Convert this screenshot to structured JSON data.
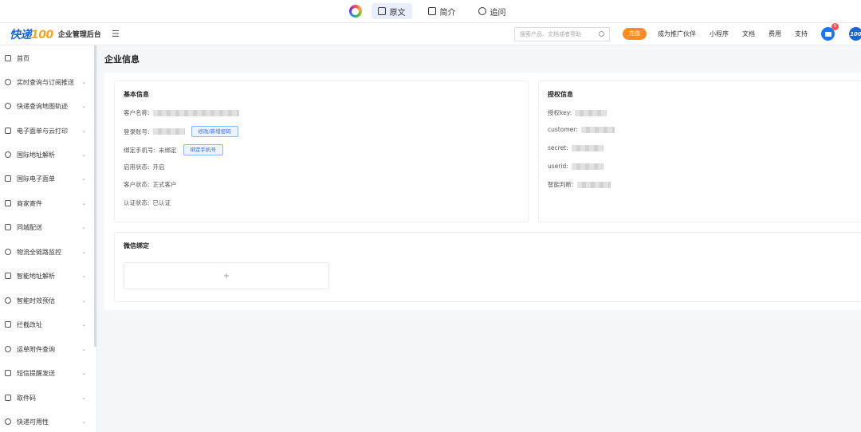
{
  "topbar": {
    "tabs": [
      {
        "label": "原文",
        "active": true
      },
      {
        "label": "简介",
        "active": false
      },
      {
        "label": "追问",
        "active": false
      }
    ]
  },
  "header": {
    "brand_cn": "快递",
    "brand_num": "100",
    "brand_title": "企业管理后台",
    "menu_toggle": "☰",
    "search_placeholder": "搜索产品、文档或者帮助",
    "recharge": "充值",
    "links": [
      "成为推广伙伴",
      "小程序",
      "文档",
      "费用",
      "支持"
    ],
    "mail_badge": "9",
    "avatar": "100"
  },
  "sidebar": {
    "items": [
      {
        "label": "首页",
        "icon": "home-icon",
        "expand": false
      },
      {
        "label": "实时查询与订阅推送",
        "icon": "location-icon",
        "expand": true
      },
      {
        "label": "快递查询地图轨迹",
        "icon": "map-icon",
        "expand": true
      },
      {
        "label": "电子面单与云打印",
        "icon": "printer-icon",
        "expand": true
      },
      {
        "label": "国际地址解析",
        "icon": "pin-icon",
        "expand": true
      },
      {
        "label": "国际电子面单",
        "icon": "document-icon",
        "expand": true
      },
      {
        "label": "商家寄件",
        "icon": "store-icon",
        "expand": true
      },
      {
        "label": "同城配送",
        "icon": "package-icon",
        "expand": true
      },
      {
        "label": "物流全链路监控",
        "icon": "monitor-icon",
        "expand": true
      },
      {
        "label": "智能地址解析",
        "icon": "send-icon",
        "expand": true
      },
      {
        "label": "智能时效预估",
        "icon": "clock-icon",
        "expand": true
      },
      {
        "label": "拦截改址",
        "icon": "edit-icon",
        "expand": true
      },
      {
        "label": "运单附件查询",
        "icon": "search-icon",
        "expand": true
      },
      {
        "label": "短信提醒发送",
        "icon": "sms-icon",
        "expand": true
      },
      {
        "label": "取件码",
        "icon": "code-icon",
        "expand": true
      },
      {
        "label": "快递可用性",
        "icon": "user-icon",
        "expand": true
      }
    ]
  },
  "page": {
    "title": "企业信息",
    "basic": {
      "heading": "基本信息",
      "customer_name_label": "客户名称:",
      "login_label": "登录账号:",
      "change_pwd_btn": "修改/新增密码",
      "phone_label": "绑定手机号:",
      "phone_value": "未绑定",
      "bind_phone_btn": "绑定手机号",
      "status_label": "启用状态:",
      "status_value": "开启",
      "cust_status_label": "客户状态:",
      "cust_status_value": "正式客户",
      "auth_label": "认证状态:",
      "auth_value": "已认证"
    },
    "auth": {
      "heading": "授权信息",
      "key_label": "授权key:",
      "customer_label": "customer:",
      "secret_label": "secret:",
      "userid_label": "userid:",
      "smart_label": "智能判断:"
    },
    "wechat": {
      "heading": "微信绑定",
      "add": "+"
    }
  }
}
